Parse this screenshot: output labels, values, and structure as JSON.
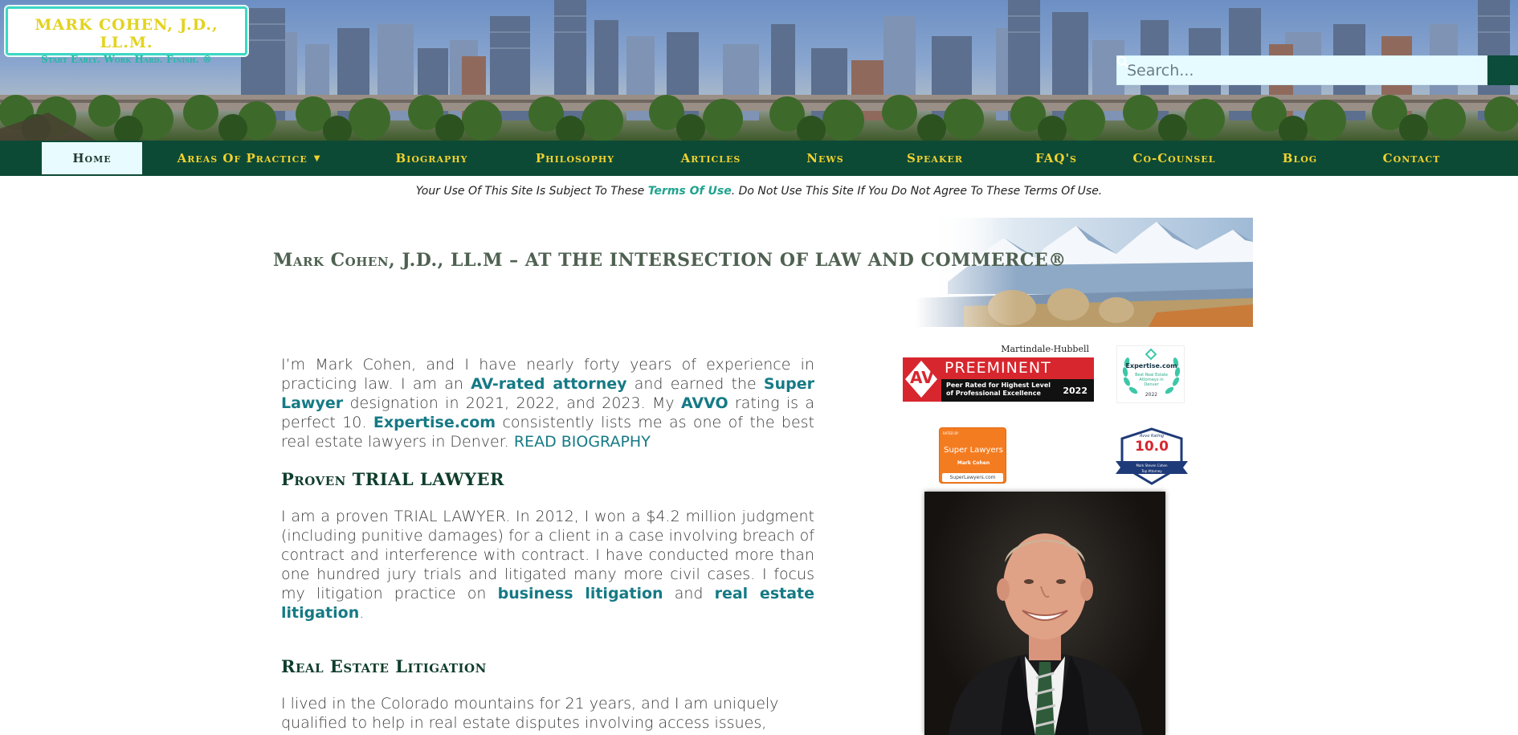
{
  "logo": {
    "title": "MARK COHEN, J.D., LL.M.",
    "tagline": "Start Early. Work Hard. Finish. ®"
  },
  "search": {
    "placeholder": "Search..."
  },
  "nav": {
    "items": [
      {
        "label": "Home",
        "active": true
      },
      {
        "label": "Areas Of Practice"
      },
      {
        "label": "Biography"
      },
      {
        "label": "Philosophy"
      },
      {
        "label": "Articles"
      },
      {
        "label": "News"
      },
      {
        "label": "Speaker"
      },
      {
        "label": "FAQ's"
      },
      {
        "label": "Co-Counsel"
      },
      {
        "label": "Blog"
      },
      {
        "label": "Contact"
      }
    ]
  },
  "notice": {
    "before": "Your Use Of This Site Is Subject To These ",
    "link": "Terms Of Use",
    "after": ". Do Not Use This Site If You Do Not Agree To These Terms Of Use."
  },
  "hero": {
    "title": "Mark Cohen, J.D., LL.M – AT THE INTERSECTION OF LAW AND COMMERCE®"
  },
  "intro": {
    "t1": "I’m Mark Cohen, and I have nearly forty years of experience in practicing law. I am an ",
    "l1": "AV-rated attorney",
    "t2": " and earned the ",
    "l2": "Super Lawyer",
    "t3": " designation in 2021, 2022, and 2023. My ",
    "l3": "AVVO",
    "t4": " rating is a perfect 10. ",
    "l4": "Expertise.com",
    "t5": " consistently lists me as one of the best real estate lawyers in Denver. ",
    "l5": "READ BIOGRAPHY"
  },
  "trial": {
    "heading": "Proven TRIAL LAWYER",
    "t1": "I am a proven TRIAL LAWYER. In 2012, I won a $4.2 million judgment (including punitive damages) for a client in a case involving breach of contract and interference with contract. I have conducted more than one hundred jury trials and litigated many more civil cases. I focus my litigation practice on ",
    "l1": "business litigation",
    "t2": " and ",
    "l2": "real estate litigation",
    "t3": "."
  },
  "realestate": {
    "heading": "Real Estate Litigation",
    "text": "I lived in the Colorado mountains for 21 years, and I am uniquely qualified to help in real estate disputes involving access issues, boundary disputes, adverse possession claims, and easements."
  },
  "badges": {
    "martindale": {
      "brand": "Martindale-Hubbell",
      "rating": "AV",
      "title": "PREEMINENT",
      "sub1": "Peer Rated for Highest Level",
      "sub2": "of Professional Excellence",
      "year": "2022"
    },
    "expertise": {
      "brand": "Expertise.com",
      "line1": "Best Real Estate",
      "line2": "Attorneys in",
      "line3": "Denver",
      "year": "2022"
    },
    "superlawyers": {
      "top": "RATED BY",
      "brand": "Super Lawyers",
      "name": "Mark Cohen",
      "site": "SuperLawyers.com"
    },
    "avvo": {
      "top": "Avvo Rating",
      "score": "10.0",
      "name": "Mark Steven Cohen",
      "ribbon": "Top Attorney"
    }
  },
  "colors": {
    "nav_bg": "#0d4a36",
    "nav_text": "#f2d22e",
    "link": "#157a85",
    "heading": "#0f3d2c"
  }
}
